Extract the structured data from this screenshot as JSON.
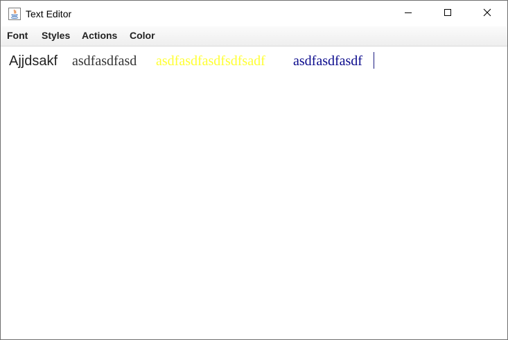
{
  "window": {
    "title": "Text Editor",
    "app_icon": "java-icon"
  },
  "controls": {
    "minimize_icon": "minimize-icon",
    "maximize_icon": "maximize-icon",
    "close_icon": "close-icon"
  },
  "menubar": {
    "items": [
      {
        "label": "Font"
      },
      {
        "label": "Styles"
      },
      {
        "label": "Actions"
      },
      {
        "label": "Color"
      }
    ]
  },
  "editor": {
    "segments": [
      {
        "text": "Ajjdsakf",
        "color": "#222222"
      },
      {
        "text": "asdfasdfasd",
        "color": "#333333"
      },
      {
        "text": "asdfasdfasdfsdfsadf",
        "color": "#ffff33"
      },
      {
        "text": "asdfasdfasdf",
        "color": "#0a0a8c"
      }
    ]
  }
}
